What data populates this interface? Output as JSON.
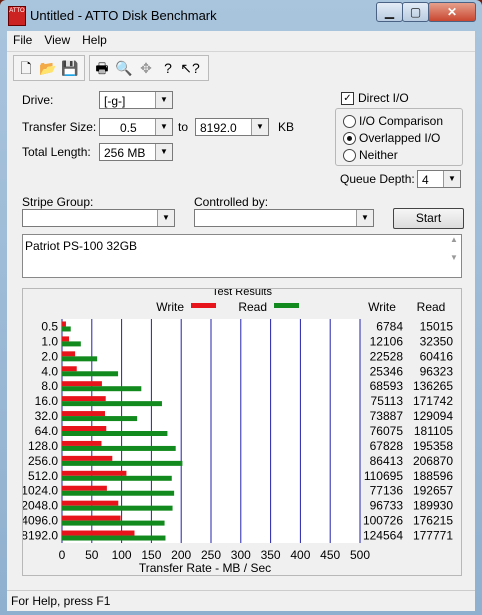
{
  "window": {
    "title": "Untitled - ATTO Disk Benchmark",
    "icon_text": "ATTO"
  },
  "menu": [
    "File",
    "View",
    "Help"
  ],
  "toolbar": [
    "new-icon",
    "open-icon",
    "save-icon",
    "print-icon",
    "print-preview-icon",
    "move-icon",
    "help-icon",
    "context-help-icon"
  ],
  "form": {
    "drive_label": "Drive:",
    "drive_value": "[-g-]",
    "transfer_size_label": "Transfer Size:",
    "transfer_from": "0.5",
    "to_label": "to",
    "transfer_to": "8192.0",
    "kb_label": "KB",
    "total_length_label": "Total Length:",
    "total_length_value": "256 MB",
    "direct_io_label": "Direct I/O",
    "direct_io_checked": "✓",
    "io_comparison_label": "I/O Comparison",
    "overlapped_io_label": "Overlapped I/O",
    "neither_label": "Neither",
    "queue_depth_label": "Queue Depth:",
    "queue_depth_value": "4",
    "stripe_group_label": "Stripe Group:",
    "stripe_group_value": "",
    "controlled_by_label": "Controlled by:",
    "controlled_by_value": "",
    "start_label": "Start",
    "description": "Patriot PS-100 32GB"
  },
  "results": {
    "title": "Test Results",
    "write_legend": "Write",
    "read_legend": "Read",
    "write_col": "Write",
    "read_col": "Read"
  },
  "chart_data": {
    "type": "bar",
    "orientation": "horizontal",
    "categories": [
      "0.5",
      "1.0",
      "2.0",
      "4.0",
      "8.0",
      "16.0",
      "32.0",
      "64.0",
      "128.0",
      "256.0",
      "512.0",
      "1024.0",
      "2048.0",
      "4096.0",
      "8192.0"
    ],
    "series": [
      {
        "name": "Write",
        "color": "#e8141c",
        "values": [
          6784,
          12106,
          22528,
          25346,
          68593,
          75113,
          73887,
          76075,
          67828,
          86413,
          110695,
          77136,
          96733,
          100726,
          124564
        ]
      },
      {
        "name": "Read",
        "color": "#138a1e",
        "values": [
          15015,
          32350,
          60416,
          96323,
          136265,
          171742,
          129094,
          181105,
          195358,
          206870,
          188596,
          192657,
          189930,
          176215,
          177771
        ]
      }
    ],
    "xlabel": "Transfer Rate - MB / Sec",
    "xticks": [
      "0",
      "50",
      "100",
      "150",
      "200",
      "250",
      "300",
      "350",
      "400",
      "450",
      "500"
    ],
    "xlim": [
      0,
      500
    ]
  },
  "status": {
    "text": "For Help, press F1"
  }
}
